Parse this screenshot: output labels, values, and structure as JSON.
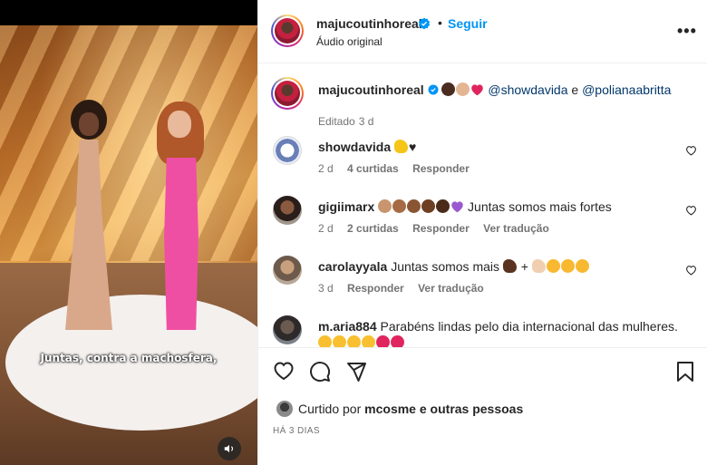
{
  "media": {
    "caption": "Juntas, contra a machosfera,",
    "audio_icon": "speaker-icon"
  },
  "header": {
    "username": "majucoutinhoreal",
    "separator": "•",
    "follow_label": "Seguir",
    "audio_label": "Áudio original",
    "more_icon": "more-options-icon",
    "more_label": "•••"
  },
  "caption_entry": {
    "username": "majucoutinhoreal",
    "mention_1": "@showdavida",
    "connector": "e",
    "mention_2": "@polianaabritta",
    "status": "Editado",
    "time": "3 d"
  },
  "comments": [
    {
      "username": "showdavida",
      "text": "",
      "time": "2 d",
      "likes": "4 curtidas",
      "reply": "Responder",
      "translate": ""
    },
    {
      "username": "gigiimarx",
      "text": "Juntas somos mais fortes",
      "time": "2 d",
      "likes": "2 curtidas",
      "reply": "Responder",
      "translate": "Ver tradução"
    },
    {
      "username": "carolayyala",
      "text": "Juntas somos mais",
      "text_plus": "+",
      "time": "3 d",
      "likes": "",
      "reply": "Responder",
      "translate": "Ver tradução"
    },
    {
      "username": "m.aria884",
      "text": "Parabéns lindas pelo dia internacional das mulheres.",
      "time": "",
      "likes": "",
      "reply": "",
      "translate": ""
    }
  ],
  "likes_summary": {
    "prefix": "Curtido por",
    "user": "mcosme",
    "connector": "e",
    "others": "outras pessoas"
  },
  "date_label": "HÁ 3 DIAS",
  "colors": {
    "accent_blue": "#0095f6",
    "meta_gray": "#737373",
    "text": "#262626",
    "mention": "#00376b"
  }
}
